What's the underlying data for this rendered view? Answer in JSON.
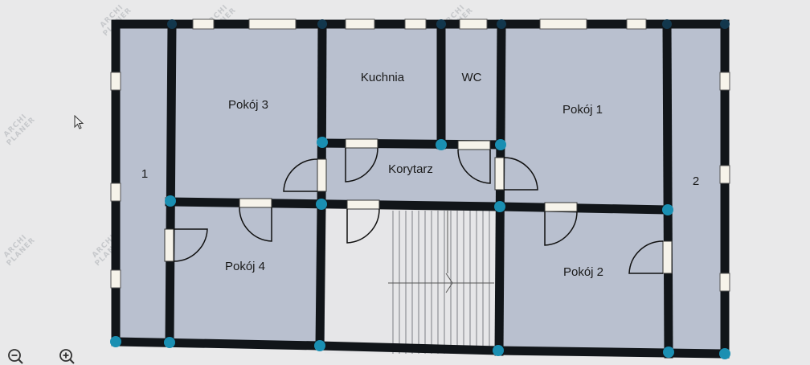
{
  "plan": {
    "rooms": {
      "r1": "1",
      "r2": "2",
      "pokoj3": "Pokój 3",
      "kuchnia": "Kuchnia",
      "wc": "WC",
      "pokoj1": "Pokój 1",
      "korytarz": "Korytarz",
      "pokoj4": "Pokój 4",
      "pokoj2": "Pokój 2"
    },
    "colors": {
      "background": "#e9e9ea",
      "floor": "#b9c0cf",
      "stair_floor": "#e6e6e8",
      "wall": "#111519",
      "node": "#1a8fb2",
      "node_dark": "#12374d",
      "window": "#f6f3ea",
      "watermark": "#c7c9cc"
    }
  },
  "watermark": {
    "line1": "ARCHI",
    "line2": "PLANER"
  },
  "toolbar": {
    "zoom_out_icon": "zoom-out-icon",
    "zoom_in_icon": "zoom-in-icon"
  }
}
